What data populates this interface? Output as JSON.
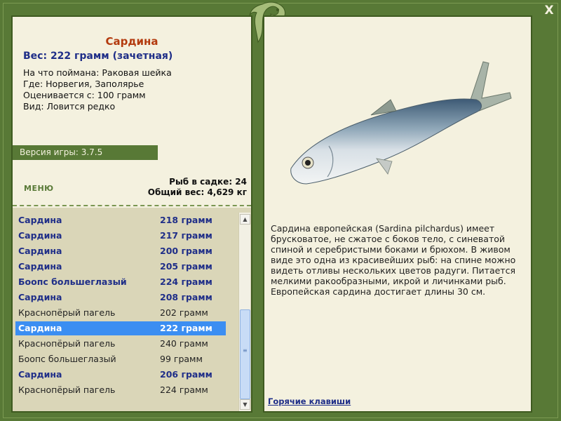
{
  "close_label": "X",
  "fish": {
    "title": "Сардина",
    "weight_line": "Вес: 222 грамм (зачетная)",
    "bait_line": "На что поймана: Раковая шейка",
    "where_line": "Где: Норвегия, Заполярье",
    "value_line": "Оценивается с: 100 грамм",
    "kind_line": "Вид: Ловится редко",
    "description": "Сардина европейская (Sardina pilchardus) имеет брусковатое, не сжатое с боков тело, с синеватой спиной и серебристыми боками и брюхом. В живом виде это одна из красивейших рыб: на спине можно видеть отливы нескольких цветов радуги. Питается мелкими ракообразными, икрой и личинками рыб. Европейская сардина достигает длины 30 см."
  },
  "version_label": "Версия игры: 3.7.5",
  "menu_label": "МЕНЮ",
  "net": {
    "count_line": "Рыб в садке: 24",
    "weight_line": "Общий вес: 4,629 кг"
  },
  "catch_list": [
    {
      "name": "Сардина",
      "weight": "218 грамм",
      "style": "trophy"
    },
    {
      "name": "Сардина",
      "weight": "217 грамм",
      "style": "trophy"
    },
    {
      "name": "Сардина",
      "weight": "200 грамм",
      "style": "trophy"
    },
    {
      "name": "Сардина",
      "weight": "205 грамм",
      "style": "trophy"
    },
    {
      "name": "Боопс большеглазый",
      "weight": "224 грамм",
      "style": "trophy"
    },
    {
      "name": "Сардина",
      "weight": "208 грамм",
      "style": "trophy"
    },
    {
      "name": "Краснопёрый пагель",
      "weight": "202 грамм",
      "style": "normal"
    },
    {
      "name": "Сардина",
      "weight": "222 грамм",
      "style": "selected"
    },
    {
      "name": "Краснопёрый пагель",
      "weight": "240 грамм",
      "style": "normal"
    },
    {
      "name": "Боопс большеглазый",
      "weight": "99 грамм",
      "style": "normal"
    },
    {
      "name": "Сардина",
      "weight": "206 грамм",
      "style": "trophy"
    },
    {
      "name": "Краснопёрый пагель",
      "weight": "224 грамм",
      "style": "normal"
    }
  ],
  "hotkeys_label": "Горячие клавиши",
  "icons": {
    "close": "close-icon",
    "logo": "fish-logo-icon",
    "scroll_up": "chevron-up-icon",
    "scroll_down": "chevron-down-icon"
  },
  "colors": {
    "frame": "#587936",
    "panel": "#f4f1df",
    "title": "#b33a0e",
    "trophy_text": "#1f2e88",
    "selection": "#3b8ef2"
  }
}
